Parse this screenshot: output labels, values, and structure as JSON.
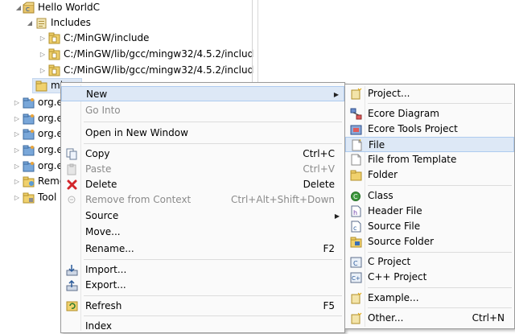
{
  "tree": {
    "project": "Hello WorldC",
    "includes": "Includes",
    "paths": [
      "C:/MinGW/include",
      "C:/MinGW/lib/gcc/mingw32/4.5.2/includ",
      "C:/MinGW/lib/gcc/mingw32/4.5.2/includ"
    ],
    "selected": "mi",
    "others": [
      "org.e",
      "org.e",
      "org.e",
      "org.e",
      "org.e",
      "Remo",
      "Tool"
    ]
  },
  "context_menu": {
    "new": "New",
    "go_into": "Go Into",
    "open_new_window": "Open in New Window",
    "copy": "Copy",
    "copy_shortcut": "Ctrl+C",
    "paste": "Paste",
    "paste_shortcut": "Ctrl+V",
    "delete": "Delete",
    "delete_shortcut": "Delete",
    "remove_context": "Remove from Context",
    "remove_context_shortcut": "Ctrl+Alt+Shift+Down",
    "source": "Source",
    "move": "Move...",
    "rename": "Rename...",
    "rename_shortcut": "F2",
    "import": "Import...",
    "export": "Export...",
    "refresh": "Refresh",
    "refresh_shortcut": "F5",
    "index": "Index"
  },
  "submenu": {
    "project": "Project...",
    "ecore_diagram": "Ecore Diagram",
    "ecore_tools_project": "Ecore Tools Project",
    "file": "File",
    "file_from_template": "File from Template",
    "folder": "Folder",
    "class": "Class",
    "header_file": "Header File",
    "source_file": "Source File",
    "source_folder": "Source Folder",
    "c_project": "C Project",
    "cpp_project": "C++ Project",
    "example": "Example...",
    "other": "Other...",
    "other_shortcut": "Ctrl+N"
  },
  "colors": {
    "highlight": "#dde8f6",
    "highlight_border": "#aecbef",
    "menu_bg": "#fafafa",
    "disabled_text": "#8b8b8b"
  }
}
